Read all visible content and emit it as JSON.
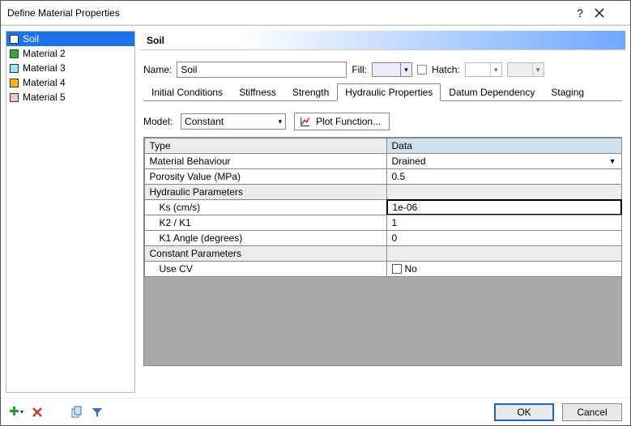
{
  "window": {
    "title": "Define Material Properties"
  },
  "materials": [
    {
      "name": "Soil",
      "color": "#ffffff"
    },
    {
      "name": "Material 2",
      "color": "#2fae2f"
    },
    {
      "name": "Material 3",
      "color": "#9fe3f5"
    },
    {
      "name": "Material 4",
      "color": "#f2b90e"
    },
    {
      "name": "Material 5",
      "color": "#f6c7c7"
    }
  ],
  "selected_material_index": 0,
  "header": {
    "material_name": "Soil"
  },
  "name_row": {
    "label": "Name:",
    "value": "Soil",
    "fill_label": "Fill:",
    "fill_color": "#ecebf7",
    "hatch_label": "Hatch:"
  },
  "tabs": [
    "Initial Conditions",
    "Stiffness",
    "Strength",
    "Hydraulic Properties",
    "Datum Dependency",
    "Staging"
  ],
  "active_tab_index": 3,
  "model_row": {
    "label": "Model:",
    "value": "Constant",
    "plot_label": "Plot Function..."
  },
  "grid": {
    "headers": {
      "type": "Type",
      "data": "Data"
    },
    "rows": [
      {
        "kind": "row",
        "label": "Material Behaviour",
        "value": "Drained",
        "dropdown": true
      },
      {
        "kind": "row",
        "label": "Porosity Value (MPa)",
        "value": "0.5"
      },
      {
        "kind": "section",
        "label": "Hydraulic Parameters"
      },
      {
        "kind": "row",
        "indent": true,
        "label": "Ks (cm/s)",
        "value": "1e-06",
        "active": true
      },
      {
        "kind": "row",
        "indent": true,
        "label": "K2 / K1",
        "value": "1"
      },
      {
        "kind": "row",
        "indent": true,
        "label": "K1 Angle (degrees)",
        "value": "0"
      },
      {
        "kind": "section",
        "label": "Constant Parameters"
      },
      {
        "kind": "row",
        "indent": true,
        "label": "Use CV",
        "value": "No",
        "checkbox": true
      }
    ]
  },
  "buttons": {
    "ok": "OK",
    "cancel": "Cancel"
  }
}
